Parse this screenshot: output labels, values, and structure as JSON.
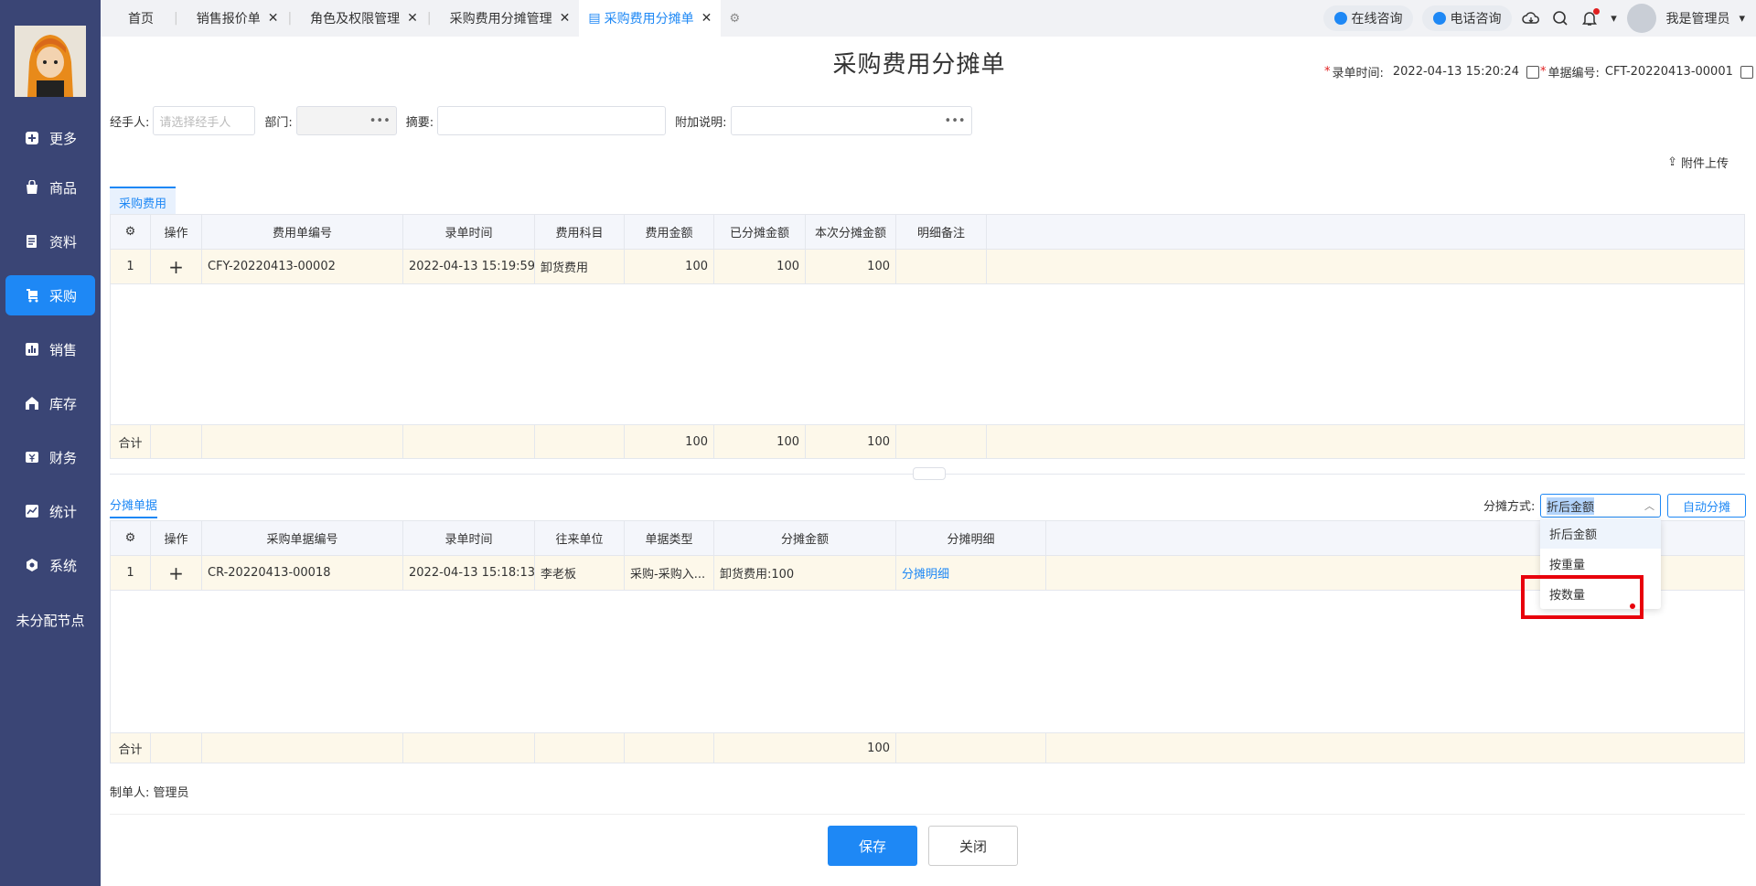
{
  "nav": {
    "items": [
      {
        "label": "更多",
        "icon": "plus-square-icon"
      },
      {
        "label": "商品",
        "icon": "bag-icon"
      },
      {
        "label": "资料",
        "icon": "document-icon"
      },
      {
        "label": "采购",
        "icon": "cart-icon"
      },
      {
        "label": "销售",
        "icon": "chart-icon"
      },
      {
        "label": "库存",
        "icon": "warehouse-icon"
      },
      {
        "label": "财务",
        "icon": "yen-icon"
      },
      {
        "label": "统计",
        "icon": "trend-icon"
      },
      {
        "label": "系统",
        "icon": "hexagon-icon"
      }
    ],
    "active": "采购",
    "unassigned": "未分配节点"
  },
  "tabs": [
    {
      "label": "首页"
    },
    {
      "label": "销售报价单"
    },
    {
      "label": "角色及权限管理"
    },
    {
      "label": "采购费用分摊管理"
    },
    {
      "label": "采购费用分摊单"
    }
  ],
  "topbar": {
    "online": "在线咨询",
    "phone": "电话咨询",
    "user": "我是管理员"
  },
  "doc": {
    "title": "采购费用分摊单",
    "entry_time_label": "录单时间:",
    "entry_time": "2022-04-13 15:20:24",
    "doc_no_label": "单据编号:",
    "doc_no": "CFT-20220413-00001"
  },
  "form": {
    "handler_label": "经手人:",
    "handler_placeholder": "请选择经手人",
    "dept_label": "部门:",
    "summary_label": "摘要:",
    "extra_label": "附加说明:"
  },
  "upload": "附件上传",
  "cost": {
    "tab": "采购费用",
    "headers": [
      "操作",
      "费用单编号",
      "录单时间",
      "费用科目",
      "费用金额",
      "已分摊金额",
      "本次分摊金额",
      "明细备注"
    ],
    "rows": [
      {
        "idx": "1",
        "code": "CFY-20220413-00002",
        "time": "2022-04-13 15:19:59",
        "subject": "卸货费用",
        "amount": "100",
        "allocated": "100",
        "current": "100",
        "note": ""
      }
    ],
    "sum_label": "合计",
    "sum": {
      "amount": "100",
      "allocated": "100",
      "current": "100"
    }
  },
  "alloc": {
    "tab": "分摊单据",
    "mode_label": "分摊方式:",
    "mode_value": "折后金额",
    "auto_button": "自动分摊",
    "options": [
      "折后金额",
      "按重量",
      "按数量"
    ],
    "headers": [
      "操作",
      "采购单据编号",
      "录单时间",
      "往来单位",
      "单据类型",
      "分摊金额",
      "分摊明细"
    ],
    "rows": [
      {
        "idx": "1",
        "code": "CR-20220413-00018",
        "time": "2022-04-13 15:18:13",
        "partner": "李老板",
        "type": "采购-采购入...",
        "amount": "卸货费用:100",
        "detail": "分摊明细"
      }
    ],
    "sum_label": "合计",
    "sum_amount": "100"
  },
  "maker_label": "制单人:",
  "maker": "管理员",
  "buttons": {
    "save": "保存",
    "close": "关闭"
  }
}
